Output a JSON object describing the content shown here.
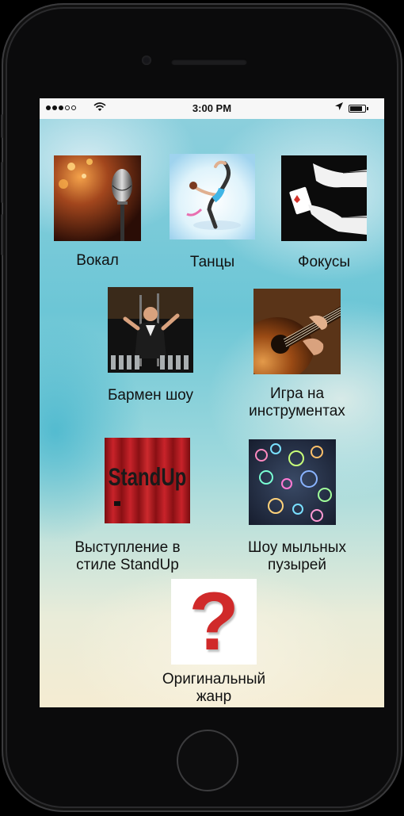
{
  "status_bar": {
    "time": "3:00 PM",
    "signal_bars_filled": 3,
    "signal_bars_total": 5,
    "wifi_icon": "wifi-icon",
    "location_icon": "location-arrow-icon",
    "battery_icon": "battery-icon"
  },
  "categories": [
    {
      "id": "vocal",
      "label": "Вокал",
      "icon": "microphone-image"
    },
    {
      "id": "dance",
      "label": "Танцы",
      "icon": "dancer-image"
    },
    {
      "id": "magic",
      "label": "Фокусы",
      "icon": "card-trick-image"
    },
    {
      "id": "bartender",
      "label": "Бармен шоу",
      "icon": "bartender-image"
    },
    {
      "id": "instruments",
      "label_line1": "Игра на",
      "label_line2": "инструментах",
      "icon": "guitar-image"
    },
    {
      "id": "standup",
      "label_line1": "Выступление в",
      "label_line2": "стиле StandUp",
      "icon": "standup-image",
      "logo_text": "StandUp"
    },
    {
      "id": "bubbles",
      "label_line1": "Шоу мыльных",
      "label_line2": "пузырей",
      "icon": "bubbles-image"
    },
    {
      "id": "original",
      "label_line1": "Оригинальный",
      "label_line2": "жанр",
      "icon": "question-mark-icon",
      "glyph": "?"
    }
  ],
  "colors": {
    "question_mark": "#d02a2a",
    "status_bar_bg": "#f7f7f7"
  }
}
